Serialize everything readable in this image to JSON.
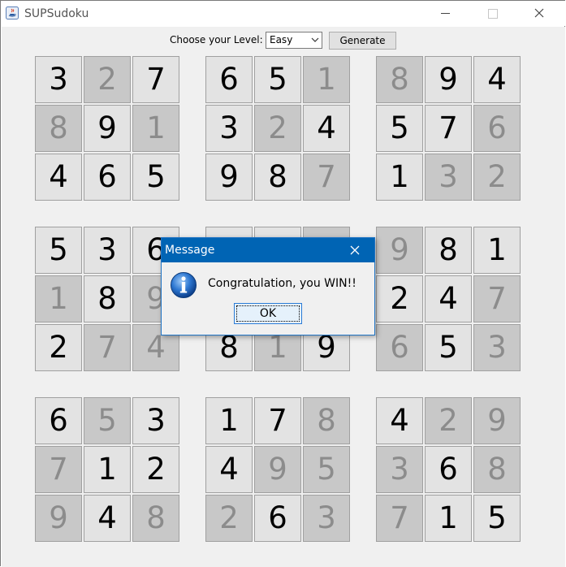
{
  "window": {
    "title": "SUPSudoku",
    "icon": "java-icon"
  },
  "toolbar": {
    "level_label": "Choose your Level:",
    "level_value": "Easy",
    "generate_label": "Generate"
  },
  "board": {
    "rows": [
      [
        {
          "v": "3",
          "given": false
        },
        {
          "v": "2",
          "given": true
        },
        {
          "v": "7",
          "given": false
        },
        {
          "v": "6",
          "given": false
        },
        {
          "v": "5",
          "given": false
        },
        {
          "v": "1",
          "given": true
        },
        {
          "v": "8",
          "given": true
        },
        {
          "v": "9",
          "given": false
        },
        {
          "v": "4",
          "given": false
        }
      ],
      [
        {
          "v": "8",
          "given": true
        },
        {
          "v": "9",
          "given": false
        },
        {
          "v": "1",
          "given": true
        },
        {
          "v": "3",
          "given": false
        },
        {
          "v": "2",
          "given": true
        },
        {
          "v": "4",
          "given": false
        },
        {
          "v": "5",
          "given": false
        },
        {
          "v": "7",
          "given": false
        },
        {
          "v": "6",
          "given": true
        }
      ],
      [
        {
          "v": "4",
          "given": false
        },
        {
          "v": "6",
          "given": false
        },
        {
          "v": "5",
          "given": false
        },
        {
          "v": "9",
          "given": false
        },
        {
          "v": "8",
          "given": false
        },
        {
          "v": "7",
          "given": true
        },
        {
          "v": "1",
          "given": false
        },
        {
          "v": "3",
          "given": true
        },
        {
          "v": "2",
          "given": true
        }
      ],
      [
        {
          "v": "5",
          "given": false
        },
        {
          "v": "3",
          "given": false
        },
        {
          "v": "6",
          "given": false
        },
        {
          "v": "",
          "given": false
        },
        {
          "v": "",
          "given": false
        },
        {
          "v": "",
          "given": true
        },
        {
          "v": "9",
          "given": true
        },
        {
          "v": "8",
          "given": false
        },
        {
          "v": "1",
          "given": false
        }
      ],
      [
        {
          "v": "1",
          "given": true
        },
        {
          "v": "8",
          "given": false
        },
        {
          "v": "9",
          "given": true
        },
        {
          "v": "",
          "given": false
        },
        {
          "v": "",
          "given": false
        },
        {
          "v": "",
          "given": false
        },
        {
          "v": "2",
          "given": false
        },
        {
          "v": "4",
          "given": false
        },
        {
          "v": "7",
          "given": true
        }
      ],
      [
        {
          "v": "2",
          "given": false
        },
        {
          "v": "7",
          "given": true
        },
        {
          "v": "4",
          "given": true
        },
        {
          "v": "8",
          "given": false
        },
        {
          "v": "1",
          "given": true
        },
        {
          "v": "9",
          "given": false
        },
        {
          "v": "6",
          "given": true
        },
        {
          "v": "5",
          "given": false
        },
        {
          "v": "3",
          "given": true
        }
      ],
      [
        {
          "v": "6",
          "given": false
        },
        {
          "v": "5",
          "given": true
        },
        {
          "v": "3",
          "given": false
        },
        {
          "v": "1",
          "given": false
        },
        {
          "v": "7",
          "given": false
        },
        {
          "v": "8",
          "given": true
        },
        {
          "v": "4",
          "given": false
        },
        {
          "v": "2",
          "given": true
        },
        {
          "v": "9",
          "given": true
        }
      ],
      [
        {
          "v": "7",
          "given": true
        },
        {
          "v": "1",
          "given": false
        },
        {
          "v": "2",
          "given": false
        },
        {
          "v": "4",
          "given": false
        },
        {
          "v": "9",
          "given": true
        },
        {
          "v": "5",
          "given": true
        },
        {
          "v": "3",
          "given": true
        },
        {
          "v": "6",
          "given": false
        },
        {
          "v": "8",
          "given": true
        }
      ],
      [
        {
          "v": "9",
          "given": true
        },
        {
          "v": "4",
          "given": false
        },
        {
          "v": "8",
          "given": true
        },
        {
          "v": "2",
          "given": true
        },
        {
          "v": "6",
          "given": false
        },
        {
          "v": "3",
          "given": true
        },
        {
          "v": "7",
          "given": true
        },
        {
          "v": "1",
          "given": false
        },
        {
          "v": "5",
          "given": false
        }
      ]
    ]
  },
  "dialog": {
    "title": "Message",
    "message": "Congratulation, you WIN!!",
    "ok_label": "OK",
    "icon": "info-icon"
  },
  "colors": {
    "dialog_header": "#0064b4",
    "cell_editable": "#e3e3e3",
    "cell_given": "#c8c8c8",
    "given_text": "#8c8c8c"
  }
}
